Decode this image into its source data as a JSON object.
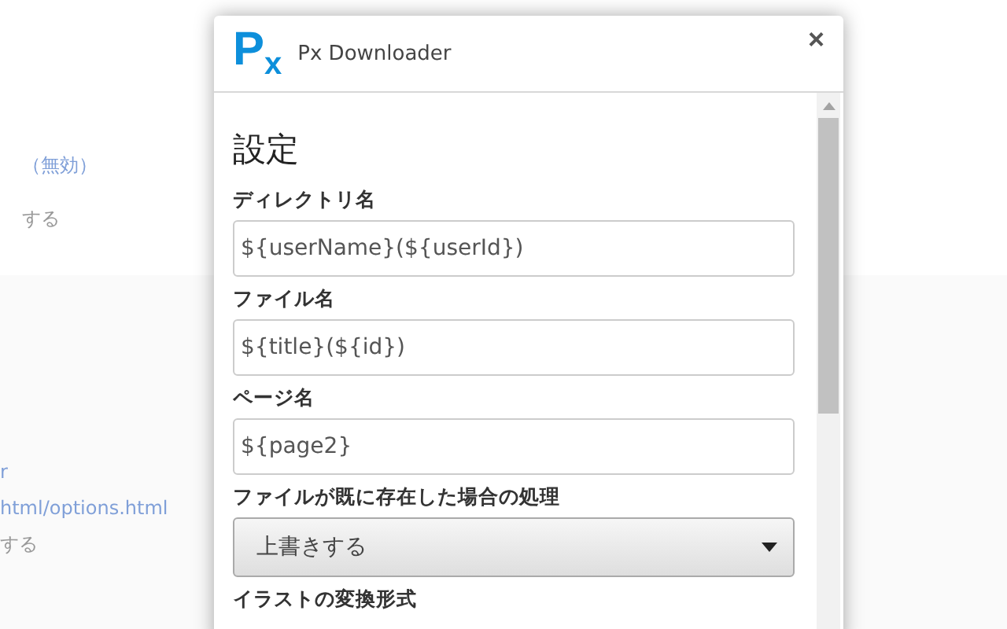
{
  "background_page": {
    "items": [
      {
        "text": "（無効）",
        "kind": "link"
      },
      {
        "text": "する",
        "kind": "plain"
      },
      {
        "text": "r",
        "kind": "link"
      },
      {
        "text": "html/options.html",
        "kind": "link"
      },
      {
        "text": "する",
        "kind": "plain"
      }
    ]
  },
  "dialog": {
    "logo": "P$_{x}$",
    "title": "Px Downloader",
    "close": "×",
    "heading": "設定",
    "fields": [
      {
        "label": "ディレクトリ名",
        "kind": "text",
        "value": "${userName}(${userId})"
      },
      {
        "label": "ファイル名",
        "kind": "text",
        "value": "${title}(${id})"
      },
      {
        "label": "ページ名",
        "kind": "text",
        "value": "${page2}"
      },
      {
        "label": "ファイルが既に存在した場合の処理",
        "kind": "select",
        "value": "上書きする"
      },
      {
        "label": "イラストの変換形式",
        "kind": "label"
      }
    ]
  }
}
